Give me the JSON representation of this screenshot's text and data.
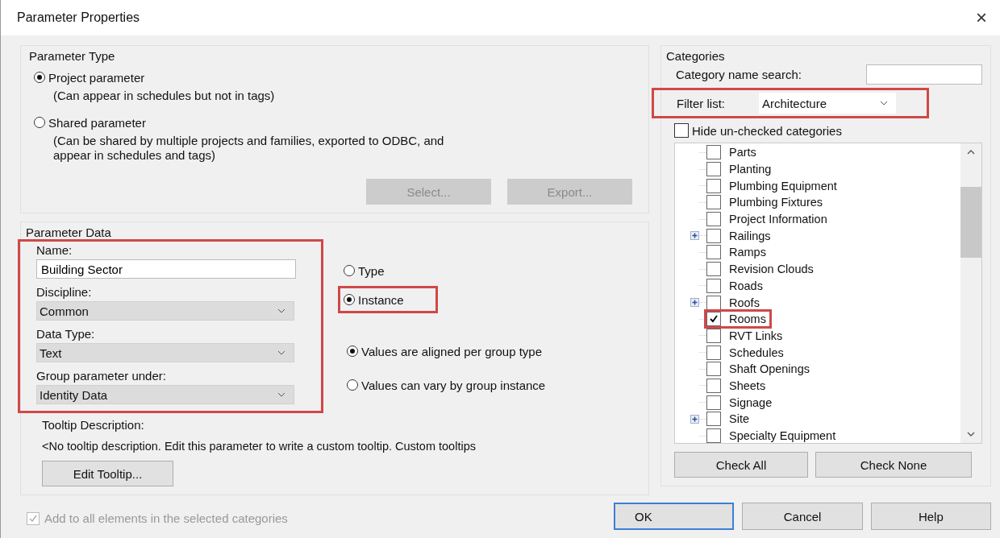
{
  "window": {
    "title": "Parameter Properties",
    "close": "×"
  },
  "parameter_type": {
    "title": "Parameter Type",
    "options": [
      {
        "label": "Project parameter",
        "selected": true,
        "note": "(Can appear in schedules but not in tags)"
      },
      {
        "label": "Shared parameter",
        "selected": false,
        "note": "(Can be shared by multiple projects and families, exported to ODBC, and appear in schedules and tags)"
      }
    ],
    "buttons": [
      {
        "label": "Select...",
        "disabled": true
      },
      {
        "label": "Export...",
        "disabled": true
      }
    ]
  },
  "parameter_data": {
    "title": "Parameter Data",
    "fields_highlighted": true,
    "fields": [
      {
        "kind": "text",
        "label": "Name:",
        "value": "Building Sector"
      },
      {
        "kind": "select",
        "label": "Discipline:",
        "value": "Common"
      },
      {
        "kind": "select",
        "label": "Data Type:",
        "value": "Text"
      },
      {
        "kind": "select",
        "label": "Group parameter under:",
        "value": "Identity Data"
      }
    ],
    "scope_options": [
      {
        "label": "Type",
        "selected": false,
        "highlighted": false
      },
      {
        "label": "Instance",
        "selected": true,
        "highlighted": true
      }
    ],
    "group_options": [
      {
        "label": "Values are aligned per group type",
        "selected": true
      },
      {
        "label": "Values can vary by group instance",
        "selected": false
      }
    ],
    "tooltip": {
      "label": "Tooltip Description:",
      "text": "<No tooltip description. Edit this parameter to write a custom tooltip. Custom tooltips",
      "button": "Edit Tooltip..."
    }
  },
  "add_to_all": {
    "label": "Add to all elements in the selected categories",
    "checked": true,
    "disabled": true
  },
  "categories": {
    "title": "Categories",
    "search_label": "Category name search:",
    "filter_label": "Filter list:",
    "filter_value": "Architecture",
    "filter_highlighted": true,
    "hide_unchecked": {
      "label": "Hide un-checked categories",
      "checked": false
    },
    "items": [
      {
        "label": "Parts",
        "checked": false,
        "expandable": false,
        "highlighted": false
      },
      {
        "label": "Planting",
        "checked": false,
        "expandable": false,
        "highlighted": false
      },
      {
        "label": "Plumbing Equipment",
        "checked": false,
        "expandable": false,
        "highlighted": false
      },
      {
        "label": "Plumbing Fixtures",
        "checked": false,
        "expandable": false,
        "highlighted": false
      },
      {
        "label": "Project Information",
        "checked": false,
        "expandable": false,
        "highlighted": false
      },
      {
        "label": "Railings",
        "checked": false,
        "expandable": true,
        "highlighted": false
      },
      {
        "label": "Ramps",
        "checked": false,
        "expandable": false,
        "highlighted": false
      },
      {
        "label": "Revision Clouds",
        "checked": false,
        "expandable": false,
        "highlighted": false
      },
      {
        "label": "Roads",
        "checked": false,
        "expandable": false,
        "highlighted": false
      },
      {
        "label": "Roofs",
        "checked": false,
        "expandable": true,
        "highlighted": false
      },
      {
        "label": "Rooms",
        "checked": true,
        "expandable": false,
        "highlighted": true
      },
      {
        "label": "RVT Links",
        "checked": false,
        "expandable": false,
        "highlighted": false
      },
      {
        "label": "Schedules",
        "checked": false,
        "expandable": false,
        "highlighted": false
      },
      {
        "label": "Shaft Openings",
        "checked": false,
        "expandable": false,
        "highlighted": false
      },
      {
        "label": "Sheets",
        "checked": false,
        "expandable": false,
        "highlighted": false
      },
      {
        "label": "Signage",
        "checked": false,
        "expandable": false,
        "highlighted": false
      },
      {
        "label": "Site",
        "checked": false,
        "expandable": true,
        "highlighted": false
      },
      {
        "label": "Specialty Equipment",
        "checked": false,
        "expandable": false,
        "highlighted": false
      }
    ],
    "buttons": [
      "Check All",
      "Check None"
    ]
  },
  "footer_buttons": [
    {
      "label": "OK",
      "default": true
    },
    {
      "label": "Cancel",
      "default": false
    },
    {
      "label": "Help",
      "default": false
    }
  ]
}
